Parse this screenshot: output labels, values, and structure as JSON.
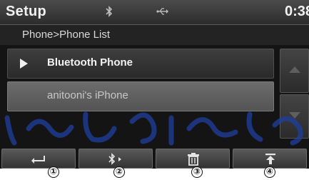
{
  "status_bar": {
    "title": "Setup",
    "clock": "0:38",
    "icons": [
      "bluetooth-icon",
      "usb-icon"
    ]
  },
  "breadcrumb": "Phone>Phone List",
  "phone_list": {
    "items": [
      {
        "label": "Bluetooth Phone",
        "icon": "play-arrow-icon",
        "selected": false
      },
      {
        "label": "anitooni's iPhone",
        "selected": true
      }
    ]
  },
  "scroll_buttons": [
    "scroll-up-icon",
    "scroll-down-icon"
  ],
  "softkeys": [
    {
      "icon": "back-icon"
    },
    {
      "icon": "bluetooth-connect-icon"
    },
    {
      "icon": "trash-icon"
    },
    {
      "icon": "move-to-top-icon"
    }
  ],
  "callouts": [
    "①",
    "②",
    "③",
    "④"
  ],
  "colors": {
    "background": "#141414",
    "status_bar": "#3a3a3a",
    "selected_row": "#606060",
    "watermark": "#1f3f9e"
  }
}
